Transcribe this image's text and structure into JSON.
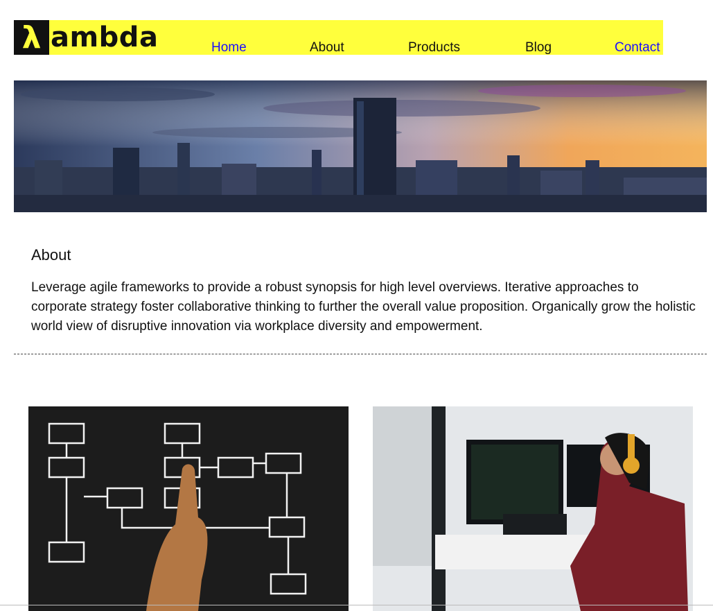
{
  "brand": {
    "logo_mark": "λ",
    "logo_text": "ambda"
  },
  "nav": {
    "items": [
      {
        "label": "Home"
      },
      {
        "label": "About"
      },
      {
        "label": "Products"
      },
      {
        "label": "Blog"
      },
      {
        "label": "Contact"
      }
    ]
  },
  "about": {
    "title": "About",
    "text": "Leverage agile frameworks to provide a robust synopsis for high level overviews. Iterative approaches to corporate strategy foster collaborative thinking to further the overall value proposition. Organically grow the holistic world view of disruptive innovation via workplace diversity and empowerment."
  },
  "colors": {
    "header_bg": "#ffff3c",
    "link_blue": "#1a0dff"
  }
}
